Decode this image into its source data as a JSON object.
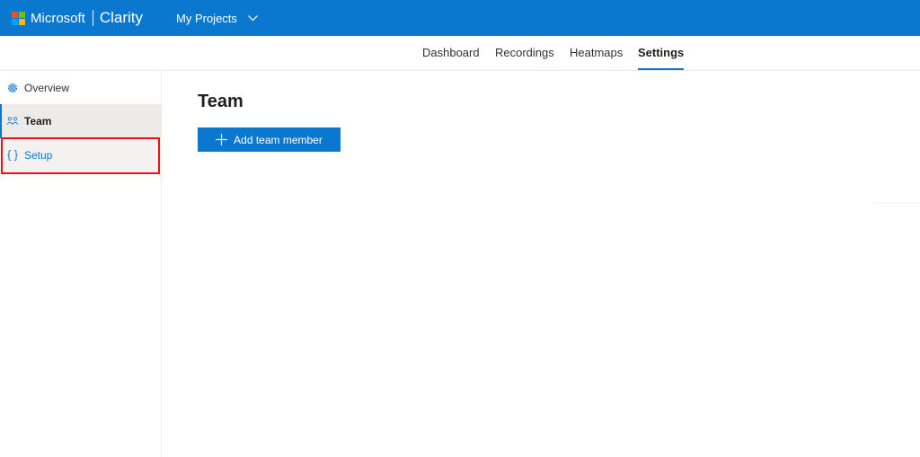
{
  "header": {
    "brand_company": "Microsoft",
    "brand_product": "Clarity",
    "project_selector_label": "My Projects",
    "logo_colors": [
      "#f25022",
      "#7fba00",
      "#00a4ef",
      "#ffb900"
    ],
    "bar_color": "#0b78d0"
  },
  "nav": {
    "tabs": [
      {
        "label": "Dashboard",
        "active": false
      },
      {
        "label": "Recordings",
        "active": false
      },
      {
        "label": "Heatmaps",
        "active": false
      },
      {
        "label": "Settings",
        "active": true
      }
    ]
  },
  "sidebar": {
    "items": [
      {
        "label": "Overview",
        "icon": "gear-icon"
      },
      {
        "label": "Team",
        "icon": "people-icon",
        "selected": true
      },
      {
        "label": "Setup",
        "icon": "code-braces-icon",
        "highlighted": true
      }
    ]
  },
  "main": {
    "title": "Team",
    "add_button_label": "Add team member"
  },
  "colors": {
    "accent": "#0b78d0",
    "highlight_border": "#e8141b"
  }
}
